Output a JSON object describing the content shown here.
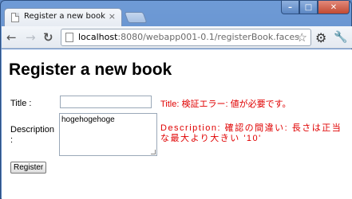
{
  "browser": {
    "tab_title": "Register a new book",
    "tab_close": "×",
    "url_host": "localhost",
    "url_path": ":8080/webapp001-0.1/registerBook.faces",
    "window_buttons": {
      "minimize": "–",
      "maximize": "□",
      "close": "✕"
    }
  },
  "page": {
    "heading": "Register a new book",
    "title_label": "Title :",
    "title_value": "",
    "title_error": "Title: 検証エラー: 値が必要です。",
    "description_label": "Description :",
    "description_value": "hogehogehoge",
    "description_error": "Description: 確認の間違い: 長さは正当な最大より大きい '10'",
    "submit_label": "Register"
  },
  "colors": {
    "error": "#e00000",
    "frame": "#5d8ac7"
  },
  "icons": [
    "page-icon",
    "back-icon",
    "forward-icon",
    "reload-icon",
    "star-icon",
    "gear-icon",
    "wrench-icon"
  ]
}
